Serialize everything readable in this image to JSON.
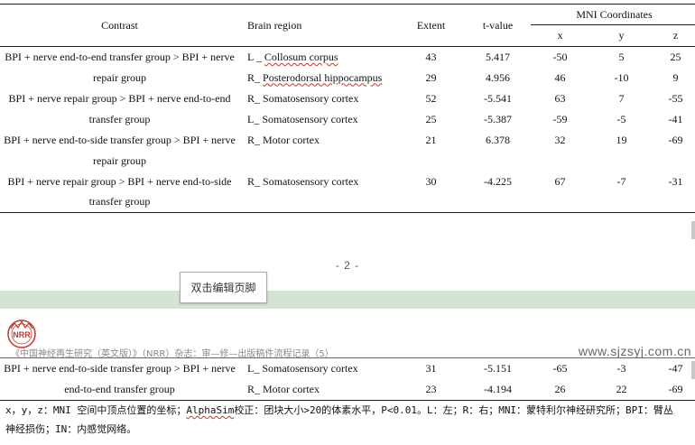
{
  "table": {
    "headers": {
      "contrast": "Contrast",
      "region": "Brain region",
      "extent": "Extent",
      "tvalue": "t-value",
      "mni": "MNI Coordinates",
      "x": "x",
      "y": "y",
      "z": "z"
    },
    "rows": [
      {
        "contrast": "BPI + nerve end-to-end transfer group > BPI + nerve",
        "region_prefix": "L _",
        "region": "Collosum corpus",
        "extent": "43",
        "t": "5.417",
        "x": "-50",
        "y": "5",
        "z": "25"
      },
      {
        "contrast": "repair group",
        "region_prefix": "R_ ",
        "region": "Posterodorsal hippocampus",
        "extent": "29",
        "t": "4.956",
        "x": "46",
        "y": "-10",
        "z": "9"
      },
      {
        "contrast": "BPI + nerve repair group > BPI + nerve end-to-end",
        "region_prefix": "R_",
        "region": "Somatosensory cortex",
        "extent": "52",
        "t": "-5.541",
        "x": "63",
        "y": "7",
        "z": "-55"
      },
      {
        "contrast": "transfer group",
        "region_prefix": "L_",
        "region": "Somatosensory cortex",
        "extent": "25",
        "t": "-5.387",
        "x": "-59",
        "y": "-5",
        "z": "-41"
      },
      {
        "contrast": "BPI + nerve end-to-side transfer group > BPI + nerve",
        "region_prefix": "R_",
        "region": "Motor cortex",
        "extent": "21",
        "t": "6.378",
        "x": "32",
        "y": "19",
        "z": "-69"
      },
      {
        "contrast": "repair group",
        "region_prefix": "",
        "region": "",
        "extent": "",
        "t": "",
        "x": "",
        "y": "",
        "z": ""
      },
      {
        "contrast": "BPI + nerve repair group > BPI + nerve end-to-side",
        "region_prefix": "R_",
        "region": "Somatosensory cortex",
        "extent": "30",
        "t": "-4.225",
        "x": "67",
        "y": "-7",
        "z": "-31"
      },
      {
        "contrast": "transfer group",
        "region_prefix": "",
        "region": "",
        "extent": "",
        "t": "",
        "x": "",
        "y": "",
        "z": ""
      }
    ],
    "rows_page2": [
      {
        "contrast": "BPI + nerve end-to-side transfer group > BPI + nerve",
        "region": "L_ Somatosensory cortex",
        "extent": "31",
        "t": "-5.151",
        "x": "-65",
        "y": "-3",
        "z": "-47"
      },
      {
        "contrast": "end-to-end transfer group",
        "region": "R_ Motor cortex",
        "extent": "23",
        "t": "-4.194",
        "x": "26",
        "y": "22",
        "z": "-69"
      }
    ]
  },
  "page_number": "- 2 -",
  "footer_button": "双击编辑页脚",
  "journal_header": "《中国神经再生研究（英文版）》（NRR）杂志：审—修—出版稿件流程记录（5）",
  "logo_text": "NRR",
  "site": "www.sjzsyj.com.cn",
  "footnote": {
    "line1_start": "x，y，z：MNI 空间中顶点位置的坐标；",
    "alphasim": "AlphaSim",
    "line1_end": "校正：团块大小>20的体素水平，P<0.01。L：左；R：右；MNI：蒙特利尔神经研究所；BPI：臂丛",
    "line2": "神经损伤；IN：内感觉网络。"
  },
  "colors": {
    "band": "#d4e4d4",
    "logo_red": "#c0392b",
    "spell_underline": "#c0392b"
  }
}
